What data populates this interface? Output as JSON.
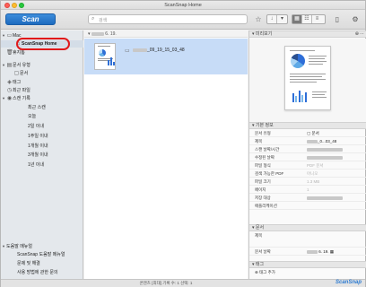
{
  "window": {
    "title": "ScanSnap Home"
  },
  "toolbar": {
    "scan_label": "Scan",
    "search_placeholder": "검색"
  },
  "sidebar": {
    "mac_label": "Mac",
    "home_label": "ScanSnap Home",
    "trash_label": "휴지통",
    "doc_types_label": "문서 유형",
    "doc_label": "문서",
    "tags_label": "태그",
    "recent_files_label": "최근 파일",
    "scan_date_label": "스캔 기록",
    "date_items": [
      "최근 스캔",
      "오늘",
      "2일 이내",
      "1주일 이내",
      "1개월 이내",
      "3개월 이내",
      "1년 이내"
    ],
    "help_label": "도움말 메뉴얼",
    "help_items": [
      "ScanSnap 도움말 메뉴얼",
      "문제 및 해결",
      "사용 방법에 관한 문의"
    ]
  },
  "list": {
    "date_header": "6. 19.",
    "doc_title_suffix": "_09_19_15_03_48"
  },
  "panel": {
    "preview_header": "미리보기",
    "props_header": "기본 정보",
    "props": [
      {
        "key": "문서 유형",
        "value": "문서"
      },
      {
        "key": "제목",
        "value": "_0...03_48"
      },
      {
        "key": "스캔 날짜/시간",
        "value": ""
      },
      {
        "key": "수정된 날짜",
        "value": ""
      },
      {
        "key": "파일 형식",
        "value": "PDF 문서"
      },
      {
        "key": "검색 가능한 PDF",
        "value": "아니오"
      },
      {
        "key": "파일 크기",
        "value": "1.3 MB"
      },
      {
        "key": "페이지",
        "value": "1"
      },
      {
        "key": "저장 대상",
        "value": ""
      },
      {
        "key": "애플리케이션",
        "value": ""
      }
    ],
    "doc_section_header": "문서",
    "doc_props": [
      {
        "key": "제목",
        "value": ""
      },
      {
        "key": "문서 날짜",
        "value": "6. 19."
      }
    ],
    "tag_section_header": "태그",
    "tag_add_label": "태그 추가"
  },
  "status": {
    "text": "콘텐츠 [최대] 기록 수: 1  선택: 1",
    "brand": "ScanSnap"
  }
}
